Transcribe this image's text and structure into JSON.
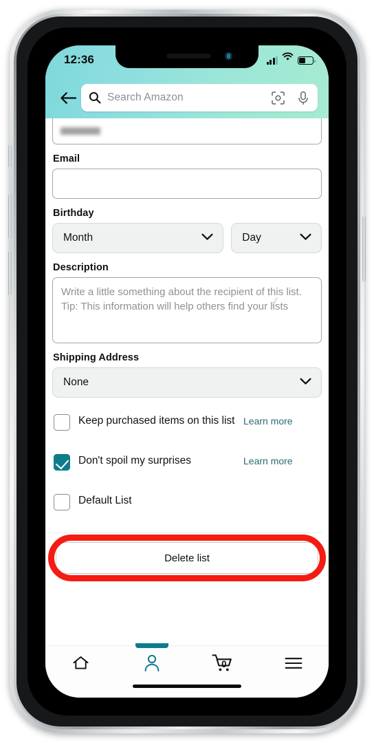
{
  "device": {
    "status_bar": {
      "time": "12:36",
      "signal_icon": "cellular-signal-icon",
      "signal_bars_filled": 3,
      "signal_bars_total": 4,
      "wifi_icon": "wifi-icon",
      "battery_icon": "battery-icon",
      "battery_percent": 47
    },
    "home_indicator": "home-indicator"
  },
  "header": {
    "back_icon": "back-arrow-icon",
    "search": {
      "search_icon": "search-icon",
      "placeholder": "Search Amazon",
      "value": "",
      "camera_icon": "camera-scan-icon",
      "mic_icon": "microphone-icon"
    },
    "gradient_from": "#7fd8dc",
    "gradient_to": "#a6ebd2"
  },
  "form": {
    "name_field": {
      "value_redacted": true
    },
    "email": {
      "label": "Email",
      "value": "",
      "placeholder": ""
    },
    "birthday": {
      "label": "Birthday",
      "month": {
        "value": "Month",
        "chevron_icon": "chevron-down-icon"
      },
      "day": {
        "value": "Day",
        "chevron_icon": "chevron-down-icon"
      }
    },
    "description": {
      "label": "Description",
      "value": "",
      "placeholder": "Write a little something about the recipient of this list. Tip: This information will help others find your lists"
    },
    "shipping_address": {
      "label": "Shipping Address",
      "value": "None",
      "chevron_icon": "chevron-down-icon"
    },
    "options": [
      {
        "label": "Keep purchased items on this list",
        "checked": false,
        "link_label": "Learn more"
      },
      {
        "label": "Don't spoil my surprises",
        "checked": true,
        "link_label": "Learn more"
      },
      {
        "label": "Default List",
        "checked": false,
        "link_label": ""
      }
    ],
    "delete_button": {
      "label": "Delete list"
    }
  },
  "annotation": {
    "shape": "oval-highlight",
    "color": "#f41b12",
    "target": "delete-list-button"
  },
  "bottom_nav": {
    "items": [
      {
        "name": "home",
        "icon": "home-icon",
        "active": false,
        "badge": ""
      },
      {
        "name": "account",
        "icon": "person-icon",
        "active": true,
        "badge": ""
      },
      {
        "name": "cart",
        "icon": "shopping-cart-icon",
        "active": false,
        "badge": "0"
      },
      {
        "name": "menu",
        "icon": "hamburger-menu-icon",
        "active": false,
        "badge": ""
      }
    ],
    "active_color": "#0d7c8a",
    "inactive_color": "#0f1111"
  }
}
